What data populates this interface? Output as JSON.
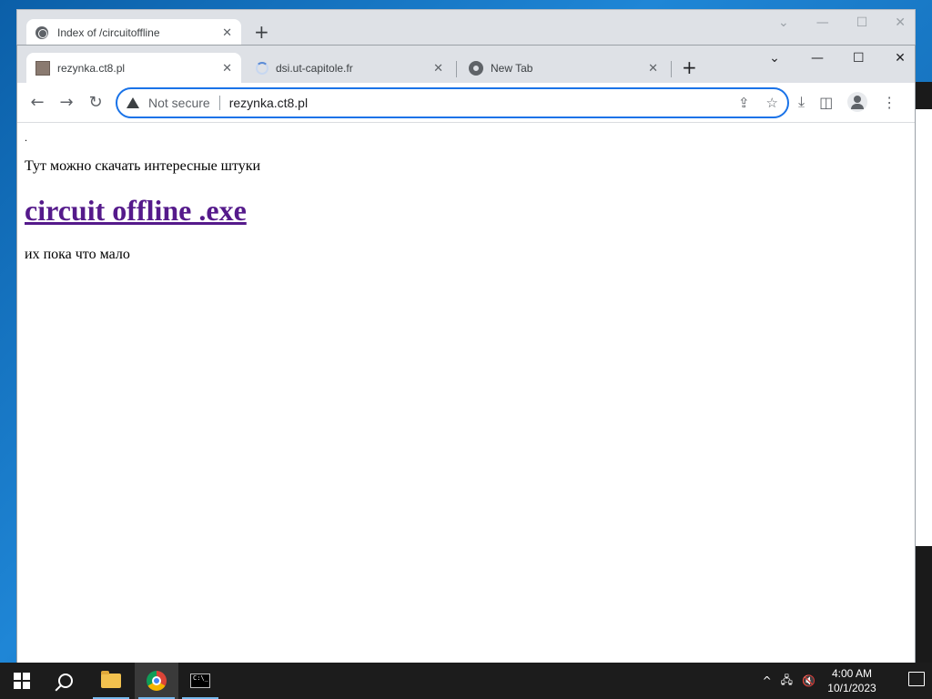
{
  "back_window": {
    "tab_title": "Index of /circuitoffline",
    "tab_close": "✕",
    "new_tab": "+",
    "controls": [
      "⌄",
      "—",
      "☐",
      "✕"
    ]
  },
  "tabs": [
    {
      "title": "rezynka.ct8.pl",
      "close": "✕"
    },
    {
      "title": "dsi.ut-capitole.fr",
      "close": "✕"
    },
    {
      "title": "New Tab",
      "close": "✕"
    }
  ],
  "new_tab": "+",
  "window_controls": [
    "⌄",
    "—",
    "☐",
    "✕"
  ],
  "toolbar": {
    "back": "←",
    "forward": "→",
    "reload": "↻",
    "security_label": "Not secure",
    "url": "rezynka.ct8.pl",
    "share_icon": "⇪",
    "star_icon": "☆",
    "download_icon": "⤓",
    "side_panel_icon": "◫",
    "menu_icon": "⋮"
  },
  "page": {
    "dot": ".",
    "intro": "Тут можно скачать интересные штуки",
    "link": "circuit offline .exe",
    "footer": "их пока что мало"
  },
  "taskbar": {
    "time": "4:00 AM",
    "date": "10/1/2023",
    "tray_icons": [
      "^",
      "🖧",
      "🔇"
    ]
  }
}
